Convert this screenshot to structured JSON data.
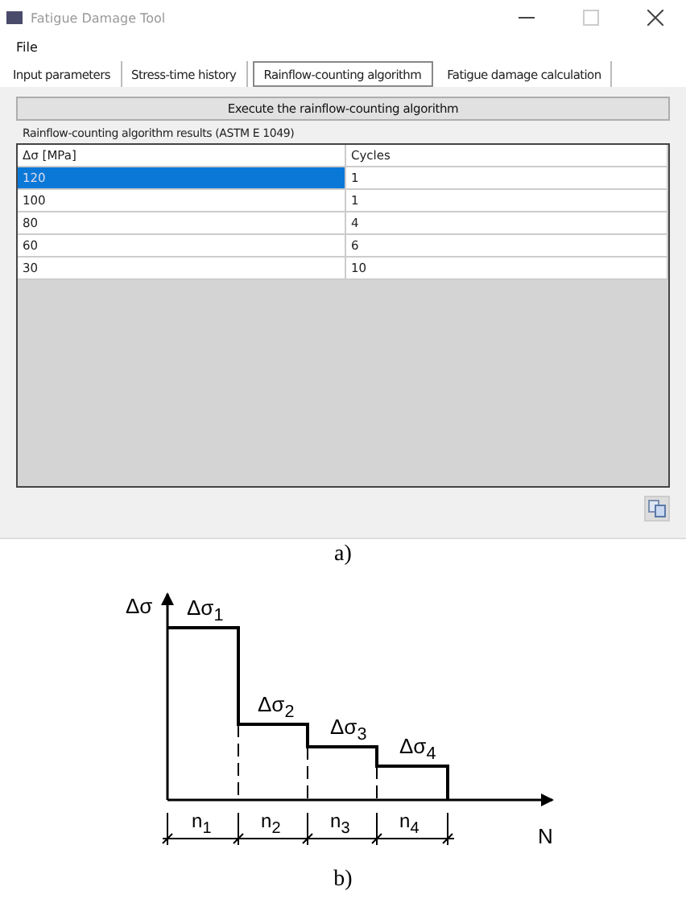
{
  "window": {
    "title": "Fatigue Damage Tool"
  },
  "menu": [
    "File"
  ],
  "tabs": [
    {
      "label": "Input parameters",
      "selected": false
    },
    {
      "label": "Stress-time history",
      "selected": false
    },
    {
      "label": "Rainflow-counting algorithm",
      "selected": true
    },
    {
      "label": "Fatigue damage calculation",
      "selected": false
    }
  ],
  "execute_button": "Execute the rainflow-counting algorithm",
  "group_label": "Rainflow-counting algorithm results (ASTM E 1049)",
  "table": {
    "columns": [
      "Δσ [MPa]",
      "Cycles"
    ],
    "rows": [
      {
        "cells": [
          "120",
          "1"
        ],
        "selected": true
      },
      {
        "cells": [
          "100",
          "1"
        ],
        "selected": false
      },
      {
        "cells": [
          "80",
          "4"
        ],
        "selected": false
      },
      {
        "cells": [
          "60",
          "6"
        ],
        "selected": false
      },
      {
        "cells": [
          "30",
          "10"
        ],
        "selected": false
      }
    ]
  },
  "caption_a": "a)",
  "diagram": {
    "y_axis_label": "Δσ",
    "x_axis_label": "N",
    "levels": [
      "Δσ$_{1}$",
      "Δσ$_{2}$",
      "Δσ$_{3}$",
      "Δσ$_{4}$"
    ],
    "counts": [
      "n$_{1}$",
      "n$_{2}$",
      "n$_{3}$",
      "n$_{4}$"
    ]
  },
  "caption_b": "b)"
}
